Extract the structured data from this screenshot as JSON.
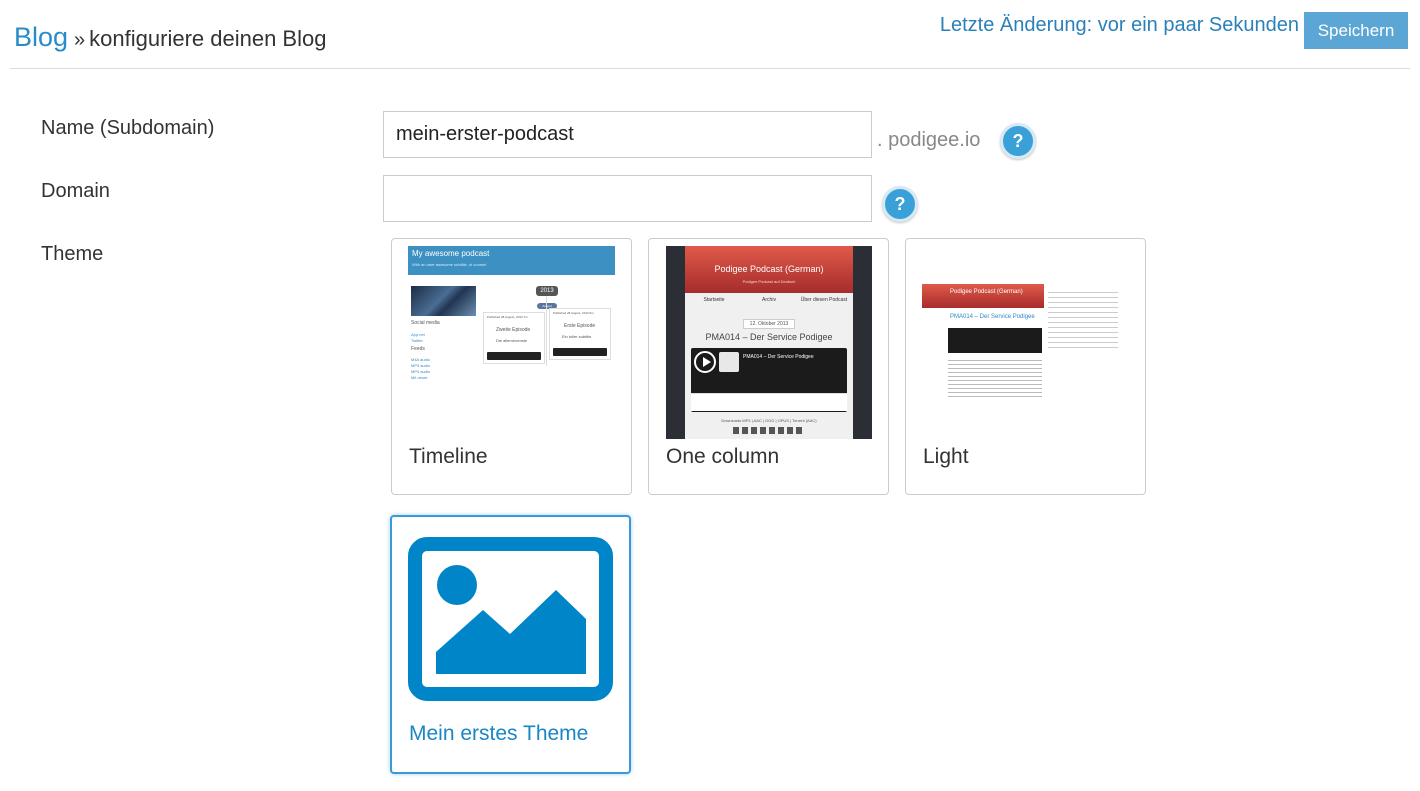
{
  "header": {
    "breadcrumb_link": "Blog",
    "breadcrumb_separator": "»",
    "breadcrumb_current": "konfiguriere deinen Blog",
    "last_change": "Letzte Änderung: vor ein paar Sekunden",
    "save_label": "Speichern"
  },
  "form": {
    "name_label": "Name (Subdomain)",
    "name_value": "mein-erster-podcast",
    "name_suffix": ". podigee.io",
    "domain_label": "Domain",
    "domain_value": "",
    "theme_label": "Theme",
    "help_glyph": "?"
  },
  "themes": [
    {
      "name": "Timeline",
      "selected": false,
      "preview": {
        "title": "My awesome podcast",
        "subtitle": "With an uber awesome subtitle, of course!",
        "year": "2013",
        "month": "August",
        "social": "Social media",
        "links_a": [
          "App.net",
          "Twitter"
        ],
        "feeds": "Feeds",
        "links_b": [
          "M4A audio",
          "MP3 audio",
          "MP4 audio",
          "Mit neuer"
        ],
        "ep1_date": "Published 28 August, 2013 7m",
        "ep1_title": "Zweite Episode",
        "ep1_sub": "Die allerneuenste",
        "ep2_date": "Published 28 August, 2013 5m",
        "ep2_title": "Erste Episode",
        "ep2_sub": "Ein toller subtitle"
      }
    },
    {
      "name": "One column",
      "selected": false,
      "preview": {
        "title": "Podigee Podcast (German)",
        "subtitle": "Podigee Podcast auf Deutsch",
        "nav": [
          "Startseite",
          "Archiv",
          "Über diesen Podcast"
        ],
        "date": "12. Oktober 2013",
        "episode": "PMA014 – Der Service Podigee",
        "player_title": "PMA014 – Der Service Podigee",
        "downloads": "Downloads MP3 | AAC | OGG | OPUS | Torrent (AAC)"
      }
    },
    {
      "name": "Light",
      "selected": false,
      "preview": {
        "title": "Podigee Podcast (German)",
        "episode": "PMA014 – Der Service Podigee"
      }
    },
    {
      "name": "Mein erstes Theme",
      "selected": true
    }
  ],
  "colors": {
    "accent": "#2a8bc9",
    "save_button": "#5ba6d4",
    "help_button": "#3aa1d8",
    "placeholder_icon": "#0085c9"
  },
  "icons": {
    "help": "help-icon",
    "placeholder": "image-placeholder-icon",
    "play": "play-icon"
  }
}
